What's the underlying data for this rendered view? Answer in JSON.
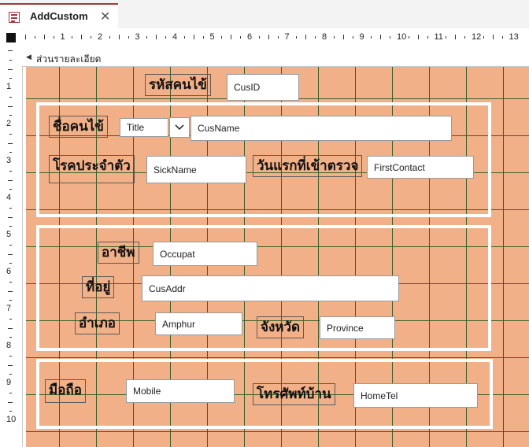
{
  "tab": {
    "title": "AddCustom",
    "close_glyph": "✕"
  },
  "ruler": {
    "h_numbers": [
      "1",
      "2",
      "3",
      "4",
      "5",
      "6",
      "7",
      "8",
      "9",
      "10",
      "11",
      "12",
      "13"
    ],
    "v_numbers": [
      "1",
      "2",
      "3",
      "4",
      "5",
      "6",
      "7",
      "8",
      "9",
      "10"
    ]
  },
  "section": {
    "label": "ส่วนรายละเอียด"
  },
  "form": {
    "cusid": {
      "label": "รหัสคนไข้",
      "field": "CusID"
    },
    "name": {
      "label": "ชื่อคนไข้",
      "title_field": "Title",
      "field": "CusName"
    },
    "sick": {
      "label": "โรคประจำตัว",
      "field": "SickName"
    },
    "first": {
      "label": "วันแรกที่เข้าตรวจ",
      "field": "FirstContact"
    },
    "occupat": {
      "label": "อาชีพ",
      "field": "Occupat"
    },
    "addr": {
      "label": "ที่อยู่",
      "field": "CusAddr"
    },
    "amphur": {
      "label": "อำเภอ",
      "field": "Amphur"
    },
    "province": {
      "label": "จังหวัด",
      "field": "Province"
    },
    "mobile": {
      "label": "มือถือ",
      "field": "Mobile"
    },
    "hometel": {
      "label": "โทรศัพท์บ้าน",
      "field": "HomeTel"
    }
  },
  "colors": {
    "detail_bg": "#f1b088",
    "grid_line": "#3d5e2a",
    "tab_accent": "#a4373a"
  }
}
